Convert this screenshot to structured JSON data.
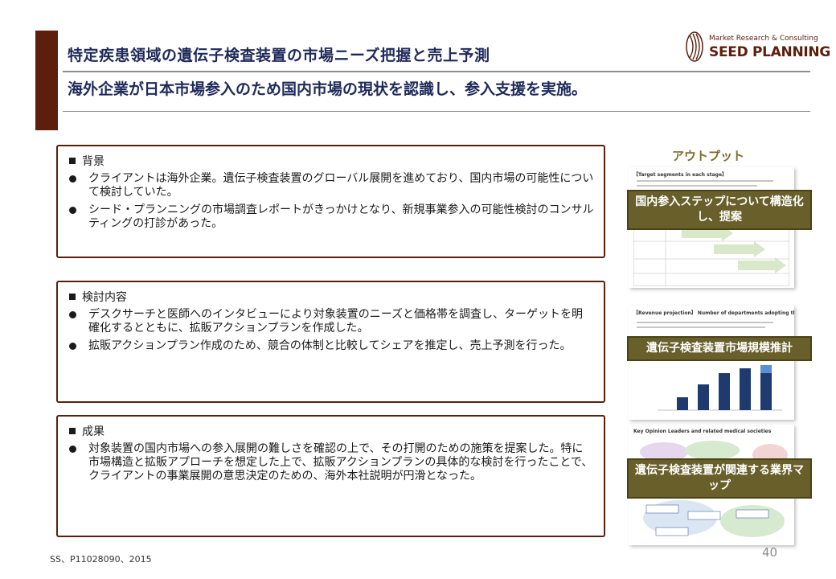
{
  "header": {
    "title": "特定疾患領域の遺伝子検査装置の市場ニーズ把握と売上予測",
    "subtitle": "海外企業が日本市場参入のため国内市場の現状を認識し、参入支援を実施。"
  },
  "logo": {
    "tagline": "Market Research & Consulting",
    "name": "SEED PLANNING"
  },
  "sections": [
    {
      "heading": "背景",
      "bullets": [
        "クライアントは海外企業。遺伝子検査装置のグローバル展開を進めており、国内市場の可能性について検討していた。",
        "シード・プランニングの市場調査レポートがきっかけとなり、新規事業参入の可能性検討のコンサルティングの打診があった。"
      ]
    },
    {
      "heading": "検討内容",
      "bullets": [
        "デスクサーチと医師へのインタビューにより対象装置のニーズと価格帯を調査し、ターゲットを明確化するとともに、拡販アクションプランを作成した。",
        "拡販アクションプラン作成のため、競合の体制と比較してシェアを推定し、売上予測を行った。"
      ]
    },
    {
      "heading": "成果",
      "bullets": [
        "対象装置の国内市場への参入展開の難しさを確認の上で、その打開のための施策を提案した。特に市場構造と拡販アプローチを想定した上で、拡販アクションプランの具体的な検討を行ったことで、クライアントの事業展開の意思決定のための、海外本社説明が円滑となった。"
      ]
    }
  ],
  "output": {
    "title": "アウトプット",
    "thumbs": [
      {
        "caption": "【Target segments in each stage】",
        "label": "国内参入ステップについて構造化し、提案"
      },
      {
        "caption": "【Revenue projection】 Number of departments adopting the panels in each year",
        "label": "遺伝子検査装置市場規模推計"
      },
      {
        "caption": "Key Opinion Leaders and related medical societies",
        "label": "遺伝子検査装置が関連する業界マップ"
      }
    ]
  },
  "footer": {
    "ref": "SS、P11028090、2015",
    "page": "40"
  },
  "colors": {
    "accent": "#5c1f0d",
    "title": "#1f2a5a",
    "label_bg": "#685f2a"
  }
}
